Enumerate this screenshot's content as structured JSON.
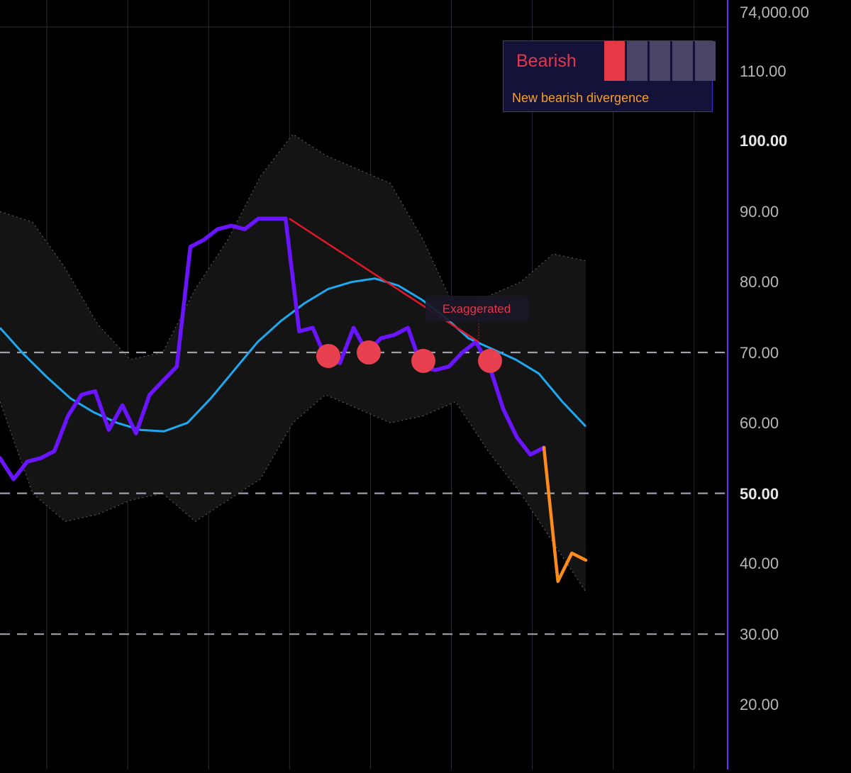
{
  "signal_panel": {
    "label": "Bearish",
    "meter": [
      true,
      false,
      false,
      false,
      false
    ],
    "message": "New bearish divergence"
  },
  "chart_data": {
    "type": "line",
    "title": "",
    "xlabel": "",
    "ylabel": "",
    "ylim": [
      10,
      114
    ],
    "y_ticks": [
      "74,000.00",
      "110.00",
      "100.00",
      "90.00",
      "80.00",
      "70.00",
      "60.00",
      "50.00",
      "40.00",
      "30.00",
      "20.00"
    ],
    "bold_ticks": [
      "100.00",
      "50.00"
    ],
    "reference_lines": [
      70,
      50,
      30
    ],
    "series": [
      {
        "role": "main",
        "color": "#6a14ff",
        "values": [
          55,
          52,
          54.5,
          55,
          56,
          61,
          64,
          64.5,
          59,
          62.5,
          58.5,
          64,
          66,
          68,
          85,
          86,
          87.5,
          88,
          87.5,
          89,
          89,
          89,
          73,
          73.5,
          69,
          68.5,
          73.5,
          70,
          72,
          72.5,
          73.5,
          68,
          67.5,
          68,
          70,
          71.5,
          68,
          62,
          58,
          55.5,
          56.5
        ]
      },
      {
        "role": "projection",
        "color": "#ff8c1a",
        "values": [
          56.5,
          37.5,
          41.5,
          40.5
        ]
      },
      {
        "role": "moving-average",
        "color": "#1ea8f0",
        "values": [
          73.5,
          69.8,
          66.5,
          63.5,
          61.5,
          60,
          59,
          58.8,
          60,
          63.5,
          67.5,
          71.5,
          74.5,
          77,
          79,
          80,
          80.5,
          79.5,
          77.5,
          75,
          72,
          70.5,
          69,
          67,
          63,
          59.5
        ]
      }
    ],
    "band": {
      "upper": [
        90,
        88.5,
        82,
        74,
        69,
        70,
        79,
        86,
        95,
        101,
        98,
        96,
        94,
        86,
        76,
        78,
        80,
        84,
        83
      ],
      "lower": [
        63,
        50,
        46,
        47,
        49,
        50,
        46,
        49,
        52,
        60,
        64,
        62,
        60,
        61,
        63,
        56,
        50,
        43,
        36
      ]
    },
    "divergence": {
      "label": "Exaggerated",
      "start": 89,
      "end": 71.5,
      "color": "#e0182a"
    },
    "signal_markers": [
      69.5,
      70,
      68.8,
      68.8
    ]
  }
}
